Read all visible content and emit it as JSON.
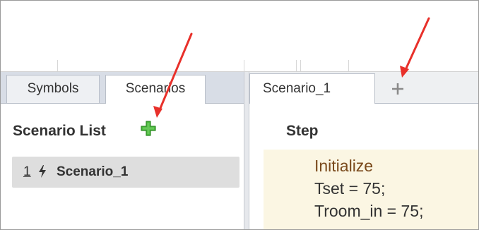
{
  "left_tabs": [
    {
      "label": "Symbols",
      "active": false
    },
    {
      "label": "Scenarios",
      "active": true
    }
  ],
  "scenario_list": {
    "header": "Scenario List",
    "add_icon": "plus-icon",
    "items": [
      {
        "index": "1",
        "icon": "bolt-icon",
        "name": "Scenario_1"
      }
    ]
  },
  "editor": {
    "tabs": [
      {
        "label": "Scenario_1",
        "active": true
      }
    ],
    "add_tab_icon": "plus-icon",
    "step_header": "Step",
    "step": {
      "title": "Initialize",
      "lines": [
        "Tset = 75;",
        "Troom_in = 75;"
      ]
    }
  },
  "colors": {
    "add_icon_green": "#49b83c",
    "annotation_arrow": "#e8302a",
    "step_background": "#fbf6e3",
    "step_title": "#7a4a1c",
    "row_highlight": "#dedede"
  }
}
